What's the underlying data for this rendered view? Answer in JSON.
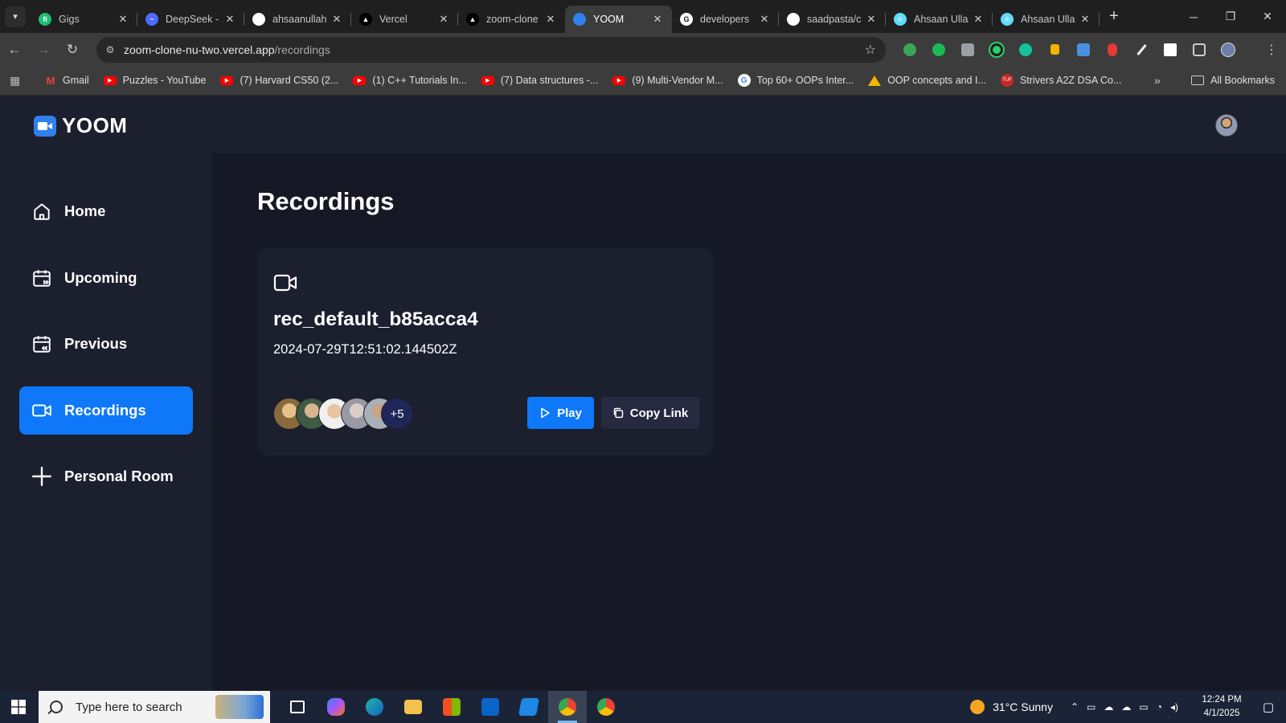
{
  "browser": {
    "tabs": [
      {
        "title": "Gigs",
        "fav_color": "#1dbf73",
        "fav_text": "fi",
        "active": false
      },
      {
        "title": "DeepSeek -",
        "fav_color": "#4d6bfe",
        "fav_text": "~",
        "active": false
      },
      {
        "title": "ahsaanullah",
        "fav_color": "#ffffff",
        "fav_text": "",
        "active": false
      },
      {
        "title": "Vercel",
        "fav_color": "#000000",
        "fav_text": "▲",
        "active": false
      },
      {
        "title": "zoom-clone",
        "fav_color": "#000000",
        "fav_text": "▲",
        "active": false
      },
      {
        "title": "YOOM",
        "fav_color": "#2f80ed",
        "fav_text": "",
        "active": true
      },
      {
        "title": "developers",
        "fav_color": "#ffffff",
        "fav_text": "G",
        "active": false
      },
      {
        "title": "saadpasta/c",
        "fav_color": "#ffffff",
        "fav_text": "",
        "active": false
      },
      {
        "title": "Ahsaan Ulla",
        "fav_color": "#61dafb",
        "fav_text": "⚛",
        "active": false
      },
      {
        "title": "Ahsaan Ulla",
        "fav_color": "#61dafb",
        "fav_text": "⚛",
        "active": false
      }
    ],
    "url_host": "zoom-clone-nu-two.vercel.app",
    "url_path": "/recordings",
    "bookmarks": [
      {
        "label": "Gmail",
        "icon": "gmail-icon"
      },
      {
        "label": "Puzzles - YouTube",
        "icon": "youtube-icon"
      },
      {
        "label": "(7) Harvard CS50 (2...",
        "icon": "youtube-icon"
      },
      {
        "label": "(1) C++ Tutorials In...",
        "icon": "youtube-icon"
      },
      {
        "label": "(7) Data structures -...",
        "icon": "youtube-icon"
      },
      {
        "label": "(9) Multi-Vendor M...",
        "icon": "youtube-icon"
      },
      {
        "label": "Top 60+ OOPs Inter...",
        "icon": "google-icon"
      },
      {
        "label": "OOP concepts and I...",
        "icon": "drive-icon"
      },
      {
        "label": "Strivers A2Z DSA Co...",
        "icon": "tuf-icon"
      }
    ],
    "all_bookmarks": "All Bookmarks"
  },
  "app": {
    "logo": "YOOM",
    "page_title": "Recordings",
    "sidebar": [
      {
        "label": "Home",
        "icon": "home-icon",
        "active": false
      },
      {
        "label": "Upcoming",
        "icon": "calendar-upcoming-icon",
        "active": false
      },
      {
        "label": "Previous",
        "icon": "calendar-previous-icon",
        "active": false
      },
      {
        "label": "Recordings",
        "icon": "video-icon",
        "active": true
      },
      {
        "label": "Personal Room",
        "icon": "plus-icon",
        "active": false
      }
    ],
    "recording": {
      "title": "rec_default_b85acca4",
      "date": "2024-07-29T12:51:02.144502Z",
      "more_attendees": "+5",
      "play_label": "Play",
      "copy_label": "Copy Link"
    },
    "colors": {
      "accent": "#0e78f9",
      "sidebar_bg": "#1c1f2e",
      "main_bg": "#161925",
      "card_bg": "#1c1f2e",
      "copy_btn": "#252a41"
    }
  },
  "taskbar": {
    "search_placeholder": "Type here to search",
    "weather": "31°C  Sunny",
    "time": "12:24 PM",
    "date": "4/1/2025"
  }
}
